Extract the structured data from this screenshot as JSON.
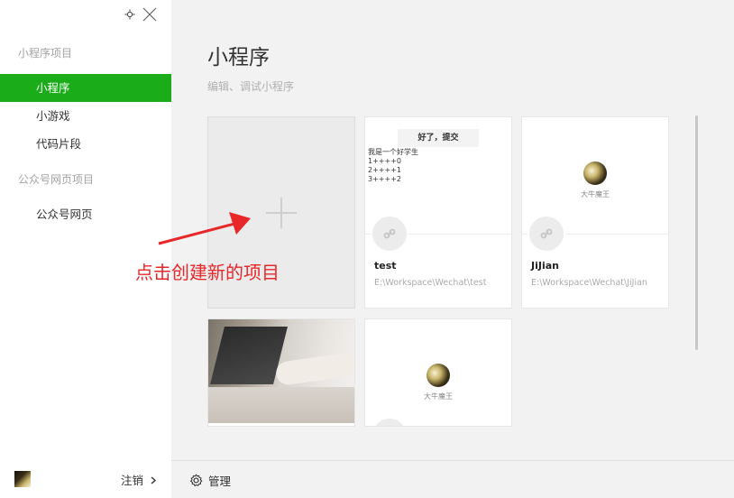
{
  "window": {
    "settings_icon": "gear-icon",
    "close_icon": "close-icon"
  },
  "sidebar": {
    "sections": [
      {
        "title": "小程序项目",
        "items": [
          "小程序",
          "小游戏",
          "代码片段"
        ]
      },
      {
        "title": "公众号网页项目",
        "items": [
          "公众号网页"
        ]
      }
    ],
    "active_item": "小程序",
    "logout_label": "注销"
  },
  "main": {
    "title": "小程序",
    "subtitle": "编辑、调试小程序",
    "projects": [
      {
        "name": "test",
        "path": "E:\\Workspace\\Wechat\\test",
        "thumb_button": "好了，提交",
        "thumb_lines": [
          "我是一个好学生",
          "1++++0",
          "2++++1",
          "3++++2"
        ]
      },
      {
        "name": "JiJian",
        "path": "E:\\Workspace\\Wechat\\JiJian",
        "thumb_label": "大牛魔王"
      },
      {
        "thumb_label": "大牛魔王"
      }
    ],
    "annotation": "点击创建新的项目"
  },
  "bottom": {
    "manage_label": "管理"
  },
  "colors": {
    "accent": "#1aad19",
    "annotation": "#e8272a"
  }
}
